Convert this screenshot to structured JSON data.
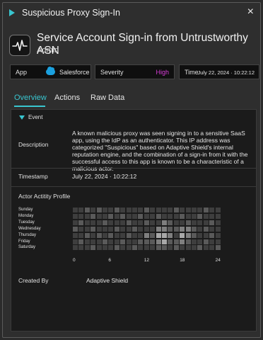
{
  "titlebar": {
    "title": "Suspicious Proxy Sign-In",
    "close_symbol": "×"
  },
  "header": {
    "title": "Service Account Sign-in from Untrustworthy ASN",
    "subtitle": "Admin",
    "icon": "activity-pulse-icon"
  },
  "fields": {
    "app": {
      "label": "App",
      "value": "Salesforce",
      "icon": "salesforce-cloud-icon"
    },
    "severity": {
      "label": "Severity",
      "value": "High",
      "color": "#d63dd6"
    },
    "time": {
      "label": "Time",
      "value": "July 22, 2024 · 10:22:12"
    }
  },
  "tabs": [
    {
      "label": "Overview",
      "active": true
    },
    {
      "label": "Actions",
      "active": false
    },
    {
      "label": "Raw Data",
      "active": false
    }
  ],
  "event": {
    "section_label": "Event",
    "description_label": "Description",
    "description": "A known malicious proxy was seen signing in to a sensitive SaaS app, using the IdP as an authenticator. This IP address was categorized \"Suspicious\" based on Adaptive Shield's internal reputation engine, and the combination of a sign-in from it with the successful access to this app is known to be a characteristic of a malicious actor.",
    "timestamp_label": "Timestamp",
    "timestamp": "July 22, 2024 · 10:22:12",
    "profile_label": "Actor Actitity Profile",
    "created_by_label": "Created By",
    "created_by": "Adaptive Shield"
  },
  "chart_data": {
    "type": "heatmap",
    "title": "Actor Actitity Profile",
    "rows": [
      "Sunday",
      "Monday",
      "Tuesday",
      "Wednesday",
      "Thursday",
      "Friday",
      "Saturday"
    ],
    "x_ticks": [
      0,
      6,
      12,
      18,
      24
    ],
    "values": [
      [
        1,
        1,
        2,
        1,
        2,
        1,
        1,
        2,
        1,
        1,
        1,
        1,
        2,
        1,
        1,
        1,
        1,
        2,
        1,
        1,
        1,
        1,
        2,
        1,
        1
      ],
      [
        1,
        1,
        1,
        2,
        1,
        1,
        2,
        1,
        2,
        1,
        1,
        2,
        1,
        1,
        2,
        1,
        1,
        1,
        2,
        1,
        1,
        2,
        1,
        1,
        1
      ],
      [
        1,
        2,
        1,
        1,
        1,
        2,
        1,
        1,
        1,
        2,
        1,
        1,
        2,
        1,
        1,
        3,
        2,
        1,
        1,
        2,
        1,
        1,
        1,
        2,
        1
      ],
      [
        2,
        1,
        1,
        2,
        1,
        1,
        1,
        2,
        1,
        1,
        2,
        1,
        1,
        1,
        3,
        3,
        2,
        2,
        3,
        3,
        2,
        1,
        2,
        1,
        1
      ],
      [
        1,
        1,
        2,
        1,
        2,
        1,
        2,
        1,
        1,
        2,
        1,
        1,
        3,
        2,
        4,
        4,
        3,
        1,
        4,
        3,
        2,
        1,
        1,
        2,
        1
      ],
      [
        1,
        2,
        1,
        1,
        1,
        2,
        1,
        1,
        2,
        1,
        1,
        2,
        2,
        2,
        3,
        4,
        2,
        2,
        3,
        2,
        1,
        1,
        2,
        1,
        1
      ],
      [
        1,
        1,
        1,
        2,
        1,
        1,
        1,
        2,
        1,
        1,
        2,
        1,
        1,
        1,
        2,
        2,
        1,
        2,
        1,
        1,
        1,
        2,
        1,
        1,
        2
      ]
    ],
    "scale_colors": [
      "#2a2a2a",
      "#3e3e3e",
      "#5a5a5a",
      "#7f7f7f",
      "#a8a8a8"
    ]
  }
}
